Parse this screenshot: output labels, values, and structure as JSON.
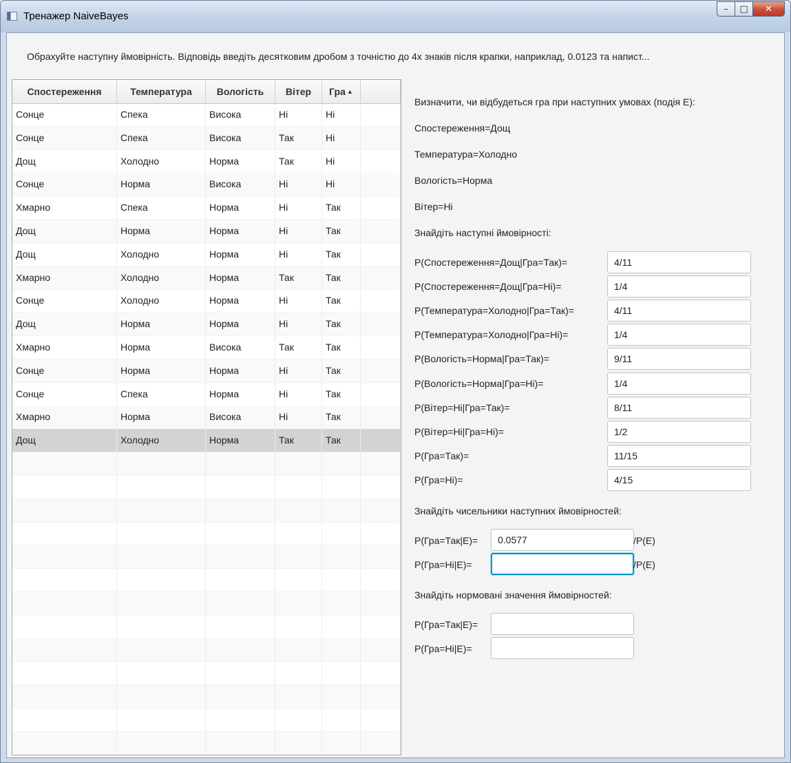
{
  "window": {
    "title": "Тренажер NaiveBayes",
    "controls": {
      "minimize": "–",
      "maximize": "□",
      "close": "✕"
    }
  },
  "instruction": "Обрахуйте наступну ймовірність. Відповідь введіть десятковим дробом з точністю до 4х знаків після крапки, наприклад, 0.0123 та напист...",
  "table": {
    "columns": [
      "Спостереження",
      "Температура",
      "Вологість",
      "Вітер",
      "Гра"
    ],
    "sorted_column": "Гра",
    "rows": [
      [
        "Сонце",
        "Спека",
        "Висока",
        "Ні",
        "Ні"
      ],
      [
        "Сонце",
        "Спека",
        "Висока",
        "Так",
        "Ні"
      ],
      [
        "Дощ",
        "Холодно",
        "Норма",
        "Так",
        "Ні"
      ],
      [
        "Сонце",
        "Норма",
        "Висока",
        "Ні",
        "Ні"
      ],
      [
        "Хмарно",
        "Спека",
        "Норма",
        "Ні",
        "Так"
      ],
      [
        "Дощ",
        "Норма",
        "Норма",
        "Ні",
        "Так"
      ],
      [
        "Дощ",
        "Холодно",
        "Норма",
        "Ні",
        "Так"
      ],
      [
        "Хмарно",
        "Холодно",
        "Норма",
        "Так",
        "Так"
      ],
      [
        "Сонце",
        "Холодно",
        "Норма",
        "Ні",
        "Так"
      ],
      [
        "Дощ",
        "Норма",
        "Норма",
        "Ні",
        "Так"
      ],
      [
        "Хмарно",
        "Норма",
        "Висока",
        "Так",
        "Так"
      ],
      [
        "Сонце",
        "Норма",
        "Норма",
        "Ні",
        "Так"
      ],
      [
        "Сонце",
        "Спека",
        "Норма",
        "Ні",
        "Так"
      ],
      [
        "Хмарно",
        "Норма",
        "Висока",
        "Ні",
        "Так"
      ],
      [
        "Дощ",
        "Холодно",
        "Норма",
        "Так",
        "Так"
      ]
    ],
    "selected_row": 14,
    "empty_rows": 13
  },
  "right": {
    "heading": "Визначити, чи відбудеться гра при наступних умовах (подія Е):",
    "conditions": [
      "Спостереження=Дощ",
      "Температура=Холодно",
      "Вологість=Норма",
      "Вітер=Ні"
    ],
    "find_probabilities": "Знайдіть наступні ймовірності:",
    "probabilities": [
      {
        "label": "P(Спостереження=Дощ|Гра=Так)=",
        "value": "4/11"
      },
      {
        "label": "P(Спостереження=Дощ|Гра=Ні)=",
        "value": "1/4"
      },
      {
        "label": "P(Температура=Холодно|Гра=Так)=",
        "value": "4/11"
      },
      {
        "label": "P(Температура=Холодно|Гра=Ні)=",
        "value": "1/4"
      },
      {
        "label": "P(Вологість=Норма|Гра=Так)=",
        "value": "9/11"
      },
      {
        "label": "P(Вологість=Норма|Гра=Ні)=",
        "value": "1/4"
      },
      {
        "label": "P(Вітер=Ні|Гра=Так)=",
        "value": "8/11"
      },
      {
        "label": "P(Вітер=Ні|Гра=Ні)=",
        "value": "1/2"
      },
      {
        "label": "P(Гра=Так)=",
        "value": "11/15"
      },
      {
        "label": "P(Гра=Ні)=",
        "value": "4/15"
      }
    ],
    "find_numerators": "Знайдіть чисельники наступних ймовірностей:",
    "numerators": [
      {
        "label": "P(Гра=Так|E)=",
        "value": "0.0577",
        "suffix": "/P(E)"
      },
      {
        "label": "P(Гра=Ні|E)=",
        "value": "",
        "suffix": "/P(E)"
      }
    ],
    "find_normalized": "Знайдіть нормовані значення ймовірностей:",
    "normalized": [
      {
        "label": "P(Гра=Так|E)=",
        "value": ""
      },
      {
        "label": "P(Гра=Ні|E)=",
        "value": ""
      }
    ]
  },
  "colors": {
    "focus": "#0096c9",
    "selected_row": "#d3d3d3"
  }
}
